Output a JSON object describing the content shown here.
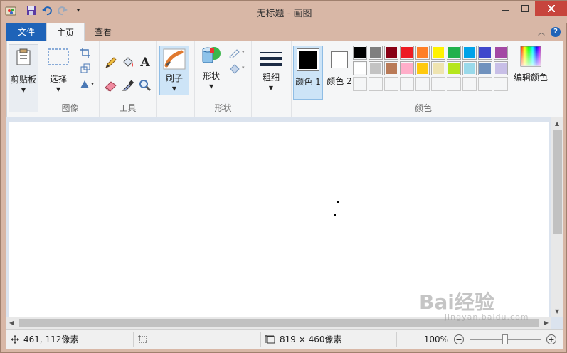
{
  "window": {
    "title": "无标题 - 画图"
  },
  "tabs": [
    {
      "label": "文件"
    },
    {
      "label": "主页"
    },
    {
      "label": "查看"
    }
  ],
  "ribbon": {
    "clipboard": {
      "label": "剪贴板"
    },
    "image": {
      "group_label": "图像",
      "select_label": "选择"
    },
    "tools": {
      "group_label": "工具"
    },
    "brush": {
      "label": "刷子"
    },
    "shapes": {
      "group_label": "形状",
      "shapes_label": "形状"
    },
    "size": {
      "label": "粗细"
    },
    "colors": {
      "group_label": "颜色",
      "color1_label": "颜色 1",
      "color2_label": "颜色 2",
      "edit_label": "编辑颜色",
      "color1": "#000000",
      "color2": "#ffffff",
      "palette_row1": [
        "#000000",
        "#7f7f7f",
        "#880015",
        "#ed1c24",
        "#ff7f27",
        "#fff200",
        "#22b14c",
        "#00a2e8",
        "#3f48cc",
        "#a349a4"
      ],
      "palette_row2": [
        "#ffffff",
        "#c3c3c3",
        "#b97a57",
        "#ffaec9",
        "#ffc90e",
        "#efe4b0",
        "#b5e61d",
        "#99d9ea",
        "#7092be",
        "#c8bfe7"
      ],
      "palette_row3": [
        "#f5f6f7",
        "#f5f6f7",
        "#f5f6f7",
        "#f5f6f7",
        "#f5f6f7",
        "#f5f6f7",
        "#f5f6f7",
        "#f5f6f7",
        "#f5f6f7",
        "#f5f6f7"
      ]
    }
  },
  "status": {
    "cursor_pos": "461, 112像素",
    "selection_size": "",
    "canvas_size": "819 × 460像素",
    "zoom": "100%"
  },
  "watermark": {
    "brand": "Bai经验",
    "url": "jingyan.baidu.com"
  }
}
